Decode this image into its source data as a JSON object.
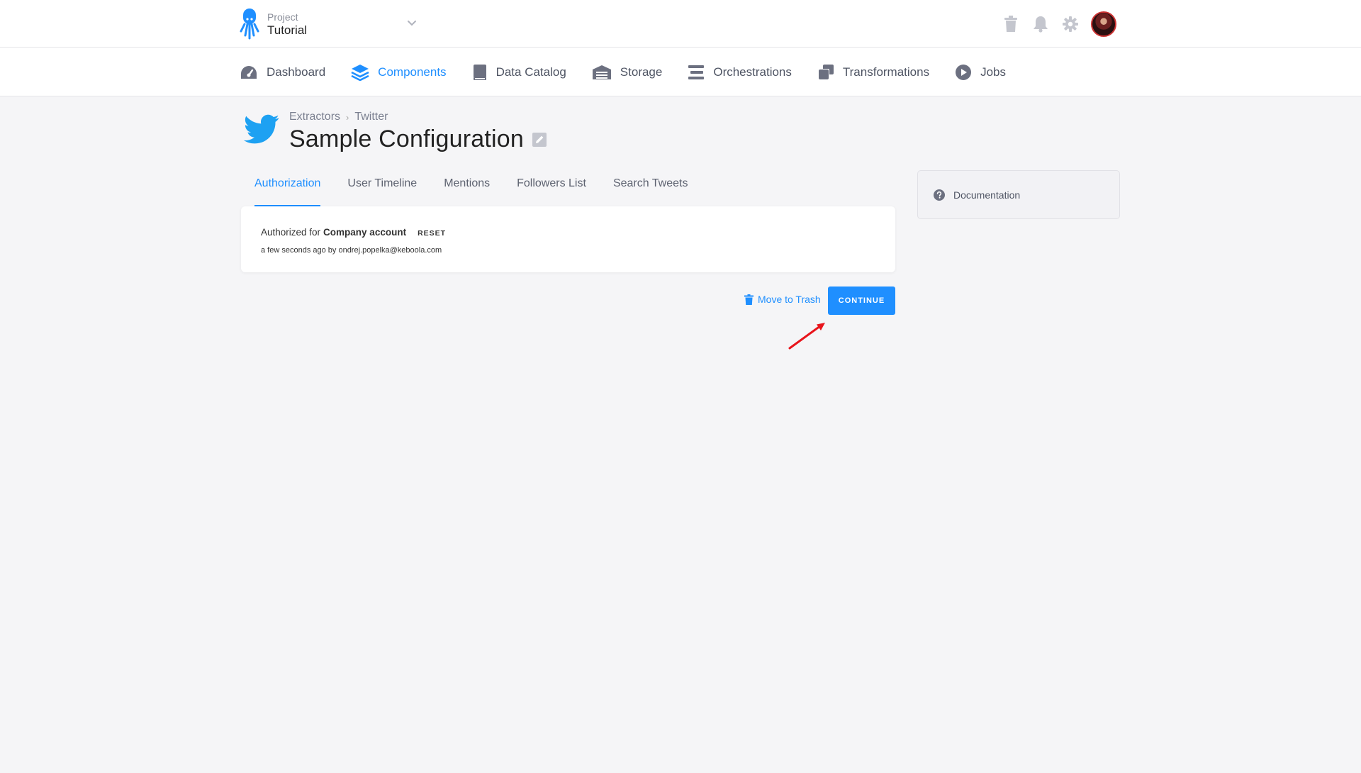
{
  "project": {
    "label": "Project",
    "name": "Tutorial"
  },
  "nav": {
    "items": [
      {
        "label": "Dashboard",
        "icon": "dashboard-icon",
        "active": false
      },
      {
        "label": "Components",
        "icon": "layers-icon",
        "active": true
      },
      {
        "label": "Data Catalog",
        "icon": "book-icon",
        "active": false
      },
      {
        "label": "Storage",
        "icon": "warehouse-icon",
        "active": false
      },
      {
        "label": "Orchestrations",
        "icon": "bars-icon",
        "active": false
      },
      {
        "label": "Transformations",
        "icon": "windows-icon",
        "active": false
      },
      {
        "label": "Jobs",
        "icon": "play-circle-icon",
        "active": false
      }
    ]
  },
  "breadcrumb": {
    "parent": "Extractors",
    "separator": "›",
    "current": "Twitter"
  },
  "page": {
    "title": "Sample Configuration"
  },
  "tabs": [
    {
      "label": "Authorization",
      "active": true
    },
    {
      "label": "User Timeline",
      "active": false
    },
    {
      "label": "Mentions",
      "active": false
    },
    {
      "label": "Followers List",
      "active": false
    },
    {
      "label": "Search Tweets",
      "active": false
    }
  ],
  "auth": {
    "prefix": "Authorized for",
    "account": "Company account",
    "reset_label": "RESET",
    "meta": "a few seconds ago by ondrej.popelka@keboola.com"
  },
  "actions": {
    "trash_label": "Move to Trash",
    "continue_label": "CONTINUE"
  },
  "sidebar": {
    "documentation_label": "Documentation"
  },
  "colors": {
    "accent": "#1f8fff",
    "background": "#f5f5f7",
    "twitter": "#1da1f2",
    "annotation_arrow": "#e8141b"
  }
}
